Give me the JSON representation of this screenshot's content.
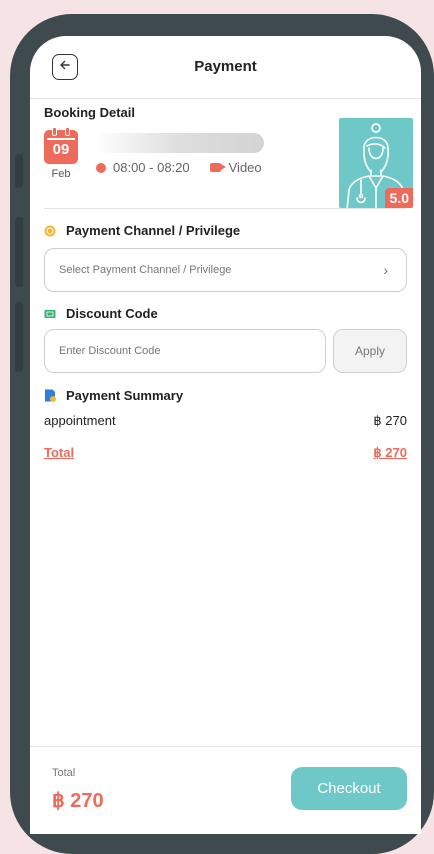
{
  "header": {
    "title": "Payment"
  },
  "booking": {
    "section_title": "Booking Detail",
    "day": "09",
    "month": "Feb",
    "time": "08:00 - 08:20",
    "type": "Video",
    "rating": "5.0"
  },
  "payment_channel": {
    "section_title": "Payment Channel / Privilege",
    "placeholder": "Select Payment Channel / Privilege"
  },
  "discount": {
    "section_title": "Discount Code",
    "placeholder": "Enter Discount Code",
    "apply_label": "Apply"
  },
  "summary": {
    "section_title": "Payment Summary",
    "item_label": "appointment",
    "item_amount": "฿ 270",
    "total_label": "Total",
    "total_amount": "฿ 270"
  },
  "footer": {
    "total_label": "Total",
    "total_amount": "฿ 270",
    "checkout_label": "Checkout"
  },
  "colors": {
    "accent": "#ee6a5a",
    "teal": "#6fc8c8",
    "frame": "#3f4a4f",
    "background": "#f6e3e6"
  },
  "icons": {
    "back": "arrow-left-icon",
    "calendar": "calendar-icon",
    "clock": "clock-icon",
    "video": "video-camera-icon",
    "coin": "coin-icon",
    "discount": "ticket-icon",
    "summary": "receipt-icon",
    "chevron": "chevron-right-icon"
  }
}
